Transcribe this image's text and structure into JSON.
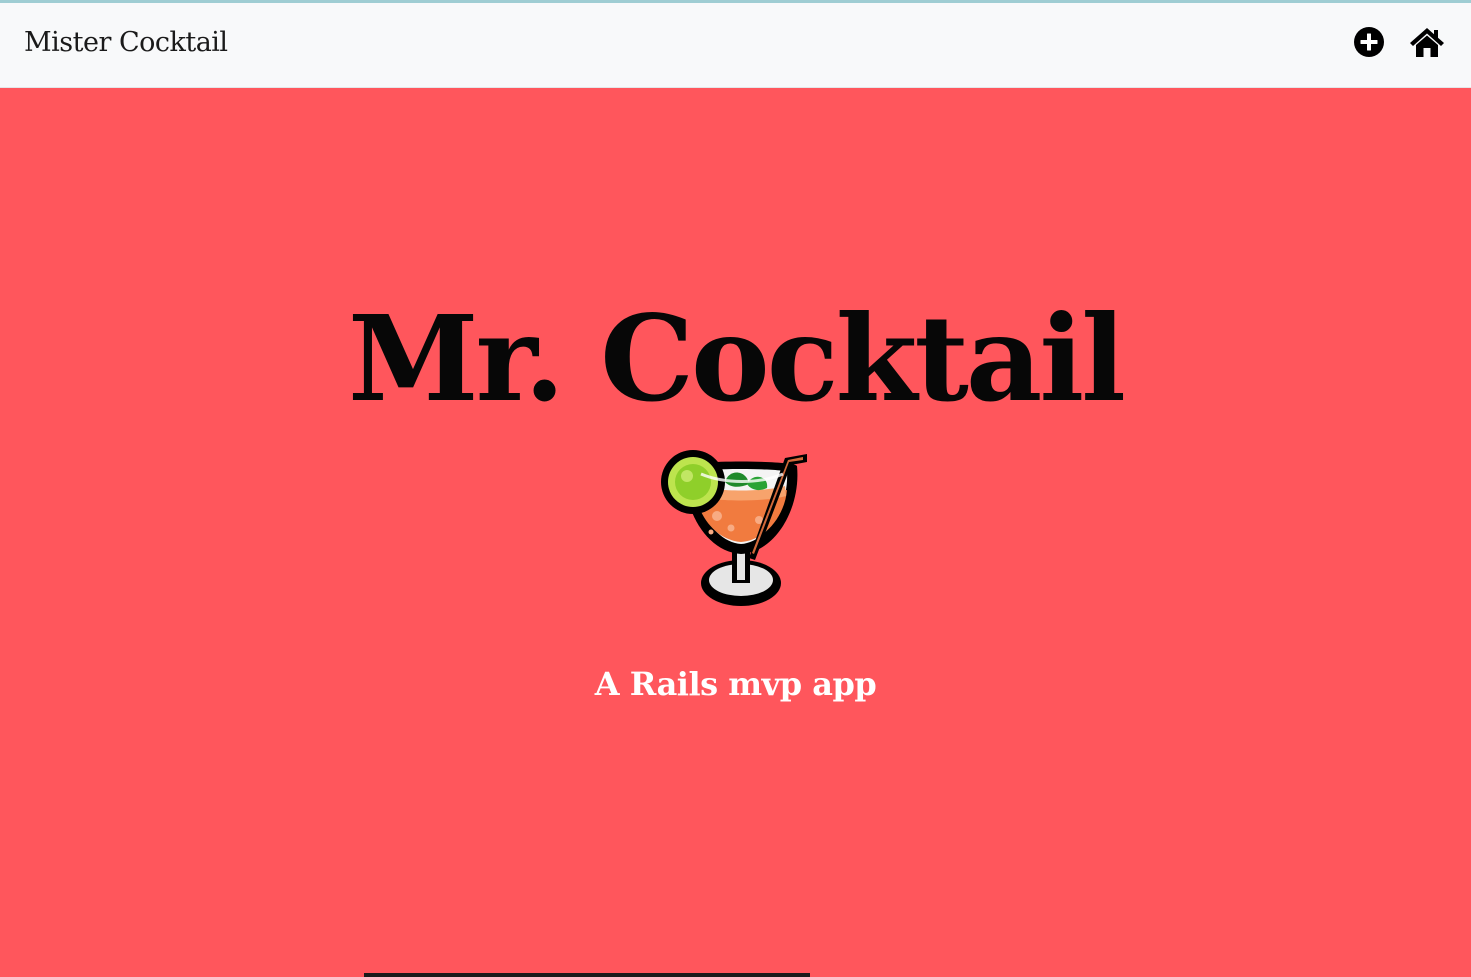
{
  "navbar": {
    "brand": "Mister Cocktail",
    "icons": [
      {
        "name": "plus-circle-icon",
        "label": "add"
      },
      {
        "name": "home-icon",
        "label": "home"
      }
    ]
  },
  "hero": {
    "title": "Mr. Cocktail",
    "emoji": "tropical-drink-icon",
    "subtitle": "A Rails mvp app"
  },
  "colors": {
    "hero_background": "#ff565c",
    "navbar_background": "#f8f9fa",
    "title_color": "#070707",
    "subtitle_color": "#ffffff"
  }
}
